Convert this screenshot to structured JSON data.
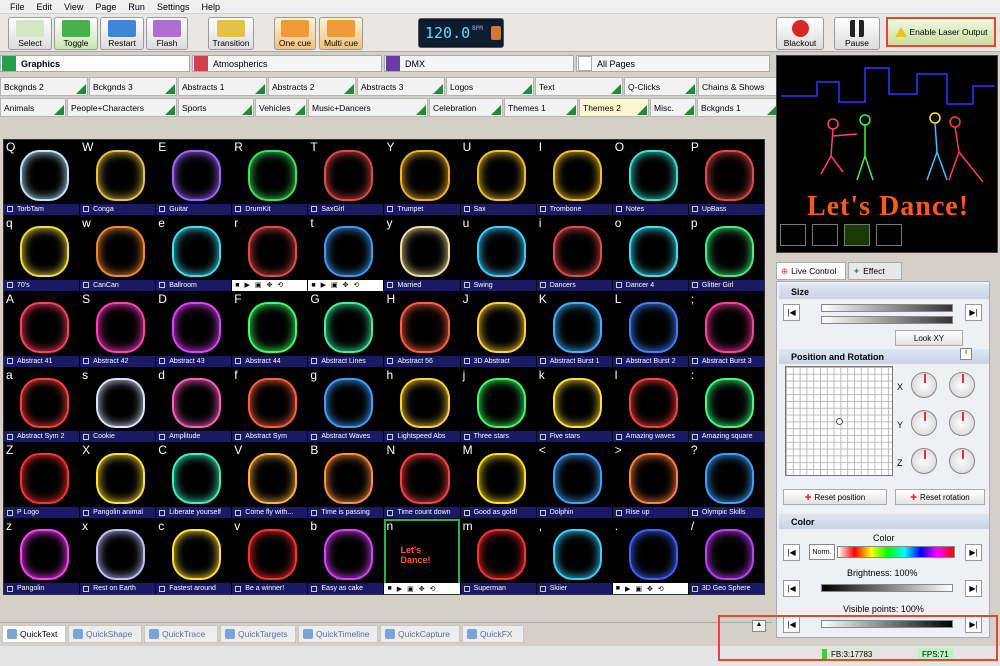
{
  "menu": [
    "File",
    "Edit",
    "View",
    "Page",
    "Run",
    "Settings",
    "Help"
  ],
  "toolbar": {
    "buttons": [
      {
        "label": "Select",
        "color": "#d3e6c5"
      },
      {
        "label": "Toggle",
        "color": "#46b34a"
      },
      {
        "label": "Restart",
        "color": "#3f86d6"
      },
      {
        "label": "Flash",
        "color": "#b06fd0"
      },
      {
        "label": "Transition",
        "color": "#e2c24a"
      },
      {
        "label": "One cue",
        "color": "#ee9a3a"
      },
      {
        "label": "Multi cue",
        "color": "#ee9a3a"
      },
      {
        "label": "Blackout",
        "color": "#d42a25"
      },
      {
        "label": "Pause",
        "color": "#222222"
      }
    ],
    "bpm_value": "120.0",
    "bpm_unit": "BPM",
    "enable_laser_label": "Enable Laser Output"
  },
  "categories": [
    {
      "label": "Graphics",
      "color": "#1fa24a"
    },
    {
      "label": "Atmospherics",
      "color": "#d2404e"
    },
    {
      "label": "DMX",
      "color": "#6a3aa8"
    },
    {
      "label": "All Pages",
      "color": "#ffffff"
    }
  ],
  "page_tabs_row1": [
    "Bckgnds 2",
    "Bckgnds 3",
    "Abstracts 1",
    "Abstracts 2",
    "Abstracts 3",
    "Logos",
    "Text",
    "Q-Clicks",
    "Chains & Shows"
  ],
  "page_tabs_row2": [
    "Animals",
    "People+Characters",
    "Sports",
    "Vehicles",
    "Music+Dancers",
    "Celebration",
    "Themes 1",
    "Themes 2",
    "Misc.",
    "Bckgnds 1"
  ],
  "active_page_tab": "Themes 2",
  "cues": [
    {
      "key": "Q",
      "label": "TorbTam",
      "color": "#bfe6ff"
    },
    {
      "key": "W",
      "label": "Conga",
      "color": "#e9c14a"
    },
    {
      "key": "E",
      "label": "Guitar",
      "color": "#a064ff"
    },
    {
      "key": "R",
      "label": "DrumKit",
      "color": "#3fe05a"
    },
    {
      "key": "T",
      "label": "SaxGirl",
      "color": "#e04a4a"
    },
    {
      "key": "Y",
      "label": "Trumpet",
      "color": "#f0b030"
    },
    {
      "key": "U",
      "label": "Sax",
      "color": "#f0c030"
    },
    {
      "key": "I",
      "label": "Trombone",
      "color": "#f0c030"
    },
    {
      "key": "O",
      "label": "Notes",
      "color": "#3fe0d0"
    },
    {
      "key": "P",
      "label": "UpBass",
      "color": "#e04a4a"
    },
    {
      "key": "q",
      "label": "70's",
      "color": "#f0e040"
    },
    {
      "key": "w",
      "label": "CanCan",
      "color": "#f08a30"
    },
    {
      "key": "e",
      "label": "Ballroom",
      "color": "#40e0f0"
    },
    {
      "key": "r",
      "label": "",
      "color": "#e04a4a"
    },
    {
      "key": "t",
      "label": "",
      "color": "#3f9af0"
    },
    {
      "key": "y",
      "label": "Married",
      "color": "#f0e0a0"
    },
    {
      "key": "u",
      "label": "Swing",
      "color": "#40d0ff"
    },
    {
      "key": "i",
      "label": "Dancers",
      "color": "#e04a4a"
    },
    {
      "key": "o",
      "label": "Dancer 4",
      "color": "#40e0f0"
    },
    {
      "key": "p",
      "label": "Glitter Girl",
      "color": "#40f080"
    },
    {
      "key": "A",
      "label": "Abstract 41",
      "color": "#ff4060"
    },
    {
      "key": "S",
      "label": "Abstract 42",
      "color": "#ff40c0"
    },
    {
      "key": "D",
      "label": "Abstract 43",
      "color": "#e040ff"
    },
    {
      "key": "F",
      "label": "Abstract 44",
      "color": "#40ff60"
    },
    {
      "key": "G",
      "label": "Abstract Lines",
      "color": "#40f0a0"
    },
    {
      "key": "H",
      "label": "Abstract 56",
      "color": "#ff6040"
    },
    {
      "key": "J",
      "label": "3D Abstract",
      "color": "#ffd040"
    },
    {
      "key": "K",
      "label": "Abstract Burst 1",
      "color": "#40b0ff"
    },
    {
      "key": "L",
      "label": "Abstract Burst 2",
      "color": "#4080ff"
    },
    {
      "key": ";",
      "label": "Abstract Burst 3",
      "color": "#ff40a0"
    },
    {
      "key": "a",
      "label": "Abstract Sym 2",
      "color": "#ff4040"
    },
    {
      "key": "s",
      "label": "Cookie",
      "color": "#e0e0ff"
    },
    {
      "key": "d",
      "label": "Amplitude",
      "color": "#ff60c0"
    },
    {
      "key": "f",
      "label": "Abstract Sym",
      "color": "#ff6040"
    },
    {
      "key": "g",
      "label": "Abstract Waves",
      "color": "#40a0ff"
    },
    {
      "key": "h",
      "label": "Lightspeed Abs",
      "color": "#ffd040"
    },
    {
      "key": "j",
      "label": "Three stars",
      "color": "#40ff60"
    },
    {
      "key": "k",
      "label": "Five stars",
      "color": "#ffe040"
    },
    {
      "key": "l",
      "label": "Amazing waves",
      "color": "#ff4040"
    },
    {
      "key": ":",
      "label": "Amazing square",
      "color": "#40ff80"
    },
    {
      "key": "Z",
      "label": "P Logo",
      "color": "#ff3030"
    },
    {
      "key": "X",
      "label": "Pangolin animal",
      "color": "#ffe040"
    },
    {
      "key": "C",
      "label": "Liberate yourself",
      "color": "#40f0c0"
    },
    {
      "key": "V",
      "label": "Come fly with...",
      "color": "#ffb040"
    },
    {
      "key": "B",
      "label": "Time is passing",
      "color": "#ff9040"
    },
    {
      "key": "N",
      "label": "Time count down",
      "color": "#ff4040"
    },
    {
      "key": "M",
      "label": "Good as gold!",
      "color": "#ffe020"
    },
    {
      "key": "<",
      "label": "Dolphin",
      "color": "#40a0ff"
    },
    {
      "key": ">",
      "label": "Rise up",
      "color": "#ff8040"
    },
    {
      "key": "?",
      "label": "Olympic Skills",
      "color": "#40a0ff"
    },
    {
      "key": "z",
      "label": "Pangolin",
      "color": "#ff40ff"
    },
    {
      "key": "x",
      "label": "Rest on Earth",
      "color": "#c0c0ff"
    },
    {
      "key": "c",
      "label": "Fastest around",
      "color": "#ffe040"
    },
    {
      "key": "v",
      "label": "Be a winner!",
      "color": "#ff3030"
    },
    {
      "key": "b",
      "label": "Easy as cake",
      "color": "#e040ff"
    },
    {
      "key": "n",
      "label": "",
      "color": "#ff6020"
    },
    {
      "key": "m",
      "label": "Superman",
      "color": "#ff3030"
    },
    {
      "key": ",",
      "label": "Skiier",
      "color": "#40d0ff"
    },
    {
      "key": ".",
      "label": "",
      "color": "#4060ff"
    },
    {
      "key": "/",
      "label": "3D Geo Sphere",
      "color": "#c040ff"
    }
  ],
  "selected_cue": "n",
  "n_cue_text": "Let's Dance!",
  "preview": {
    "title": "Let's Dance!"
  },
  "panel_tabs": [
    "Live Control",
    "Effect"
  ],
  "panel": {
    "size_label": "Size",
    "look_xy": "Look XY",
    "position_rotation_label": "Position and Rotation",
    "axis_x": "X",
    "axis_y": "Y",
    "axis_z": "Z",
    "reset_position": "Reset position",
    "reset_rotation": "Reset rotation",
    "color_label": "Color",
    "color_sub": "Color",
    "norm": "Norm.",
    "brightness": "Brightness: 100%",
    "visible_points": "Visible points: 100%"
  },
  "bottom_tabs": [
    "QuickText",
    "QuickShape",
    "QuickTrace",
    "QuickTargets",
    "QuickTimeline",
    "QuickCapture",
    "QuickFX"
  ],
  "status": {
    "fb": "FB:3:17783",
    "fps": "FPS:71"
  }
}
